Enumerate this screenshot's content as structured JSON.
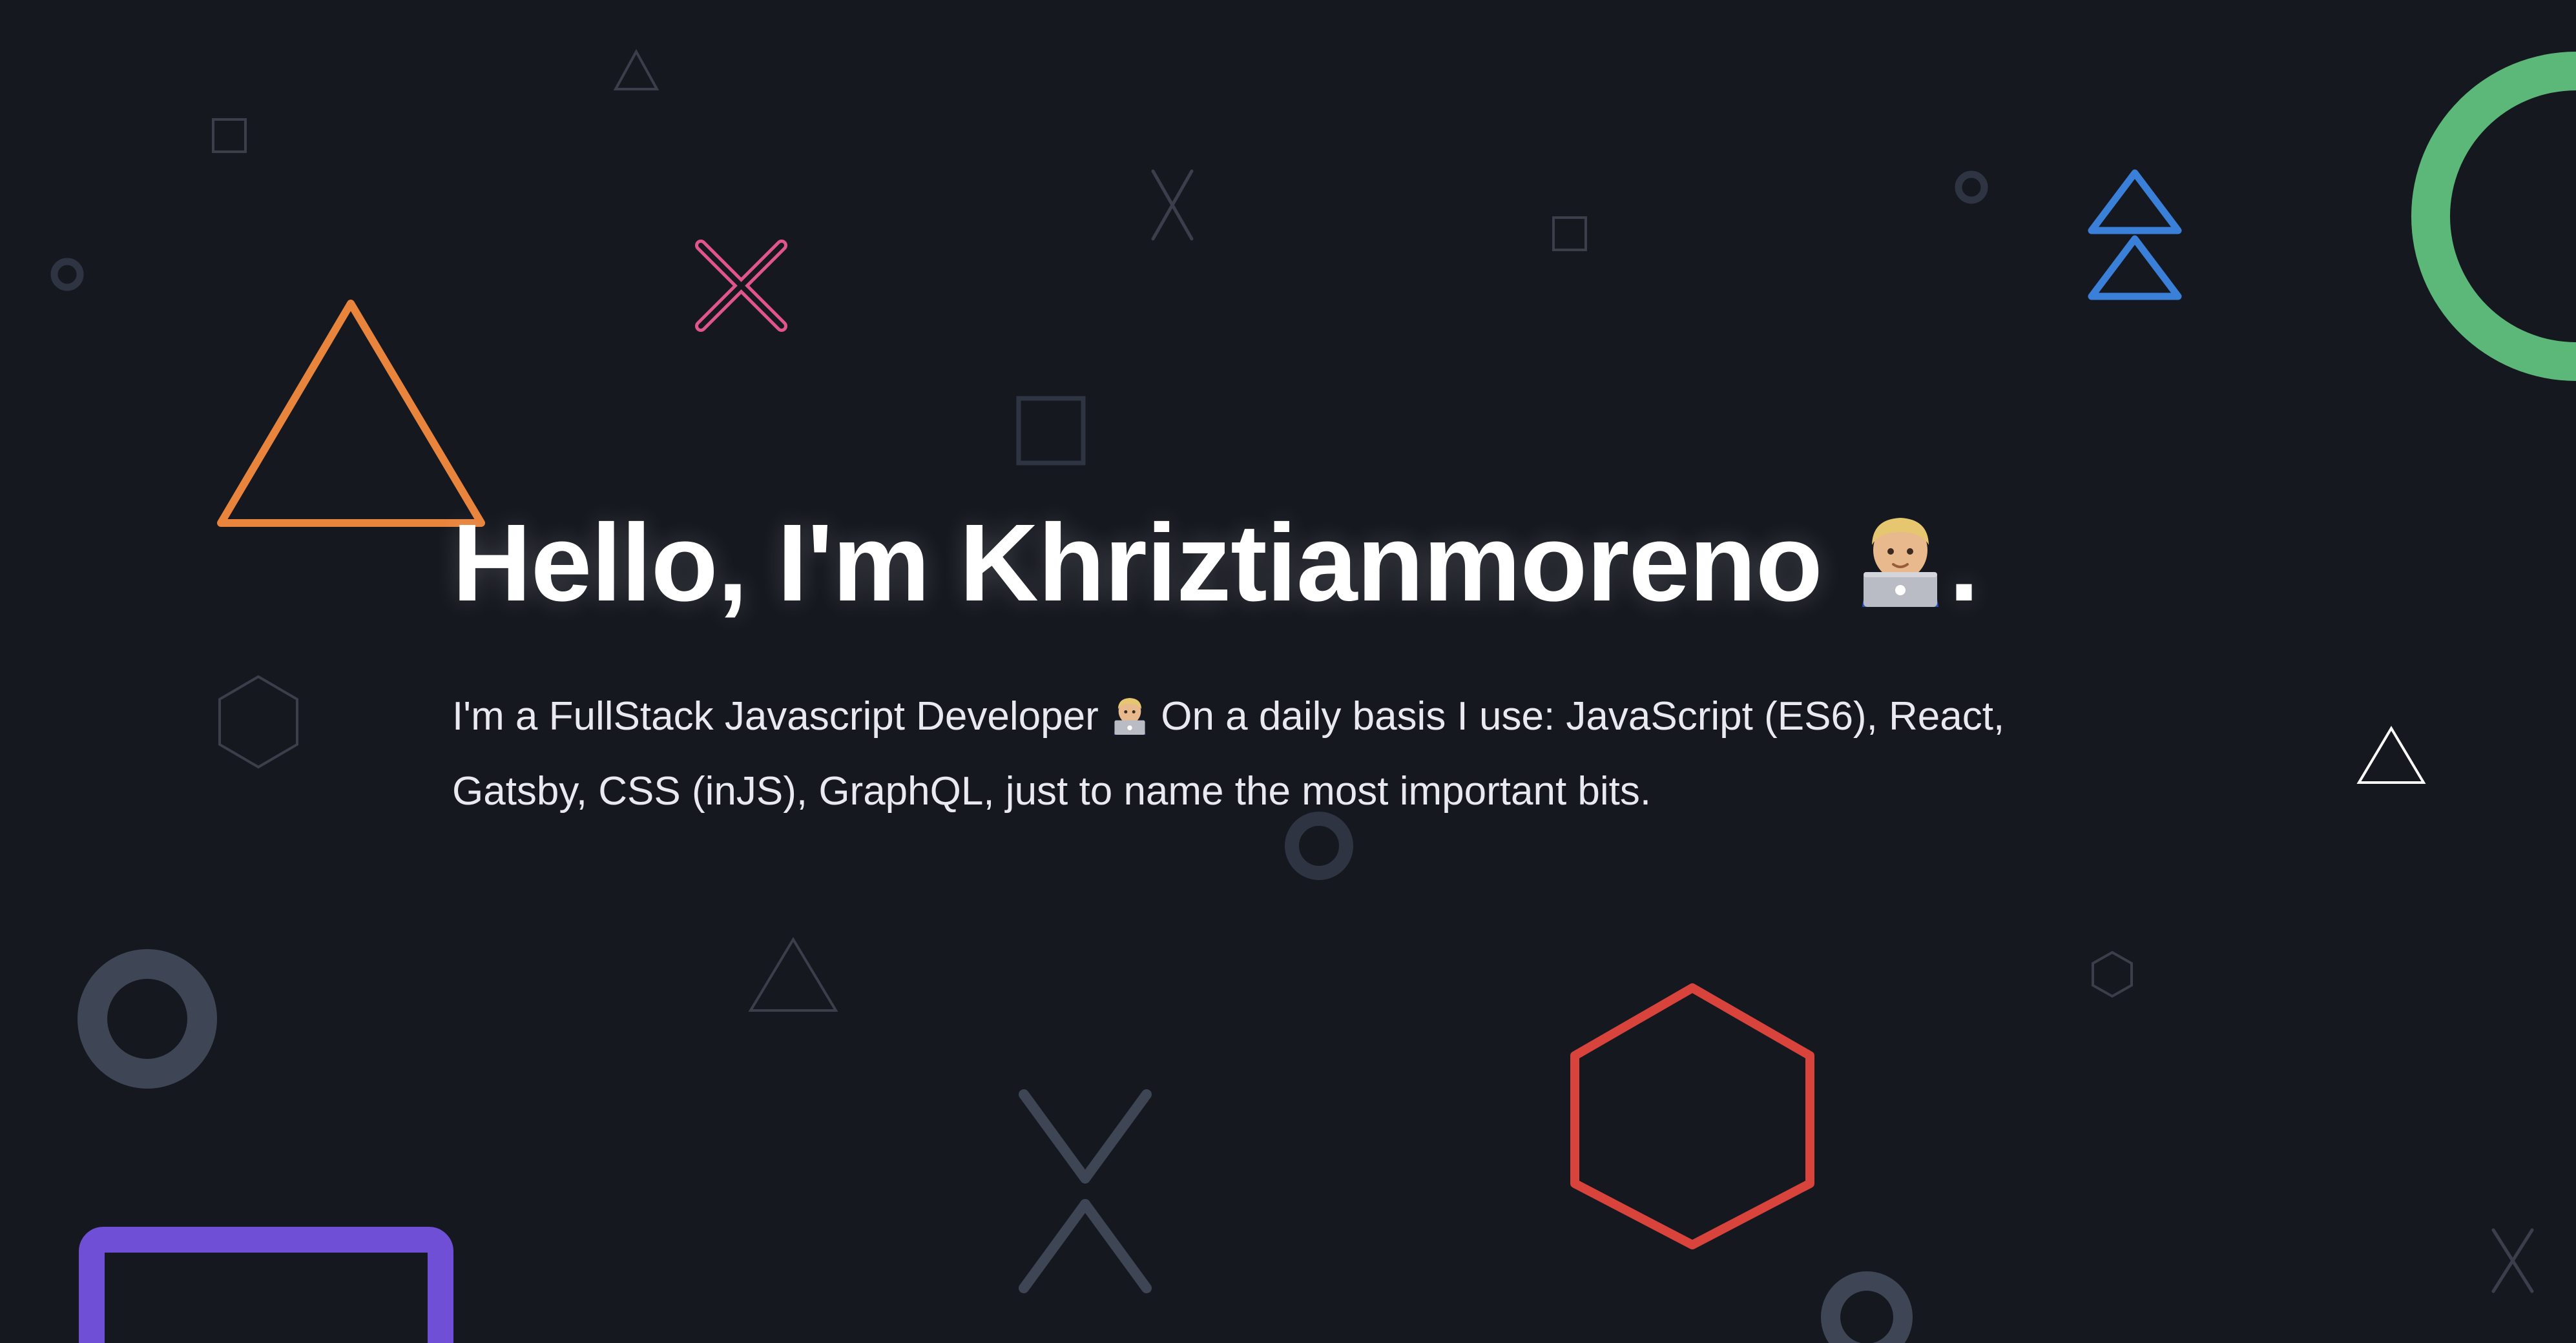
{
  "hero": {
    "greeting": "Hello, I'm Khriztianmoreno",
    "greeting_end": ".",
    "intro_before": "I'm a FullStack Javascript Developer",
    "intro_after": "On a daily basis I use: JavaScript (ES6), React, Gatsby, CSS (inJS), GraphQL, just to name the most important bits.",
    "emoji": "technologist-emoji"
  },
  "colors": {
    "background": "#161820",
    "orange": "#e8843c",
    "pink": "#e0558a",
    "blue": "#3a80d8",
    "green": "#5cb878",
    "red": "#d8433c",
    "purple": "#6f4fd6",
    "slate": "#3e4656",
    "faint": "#3a3f4b",
    "white": "#ffffff"
  }
}
